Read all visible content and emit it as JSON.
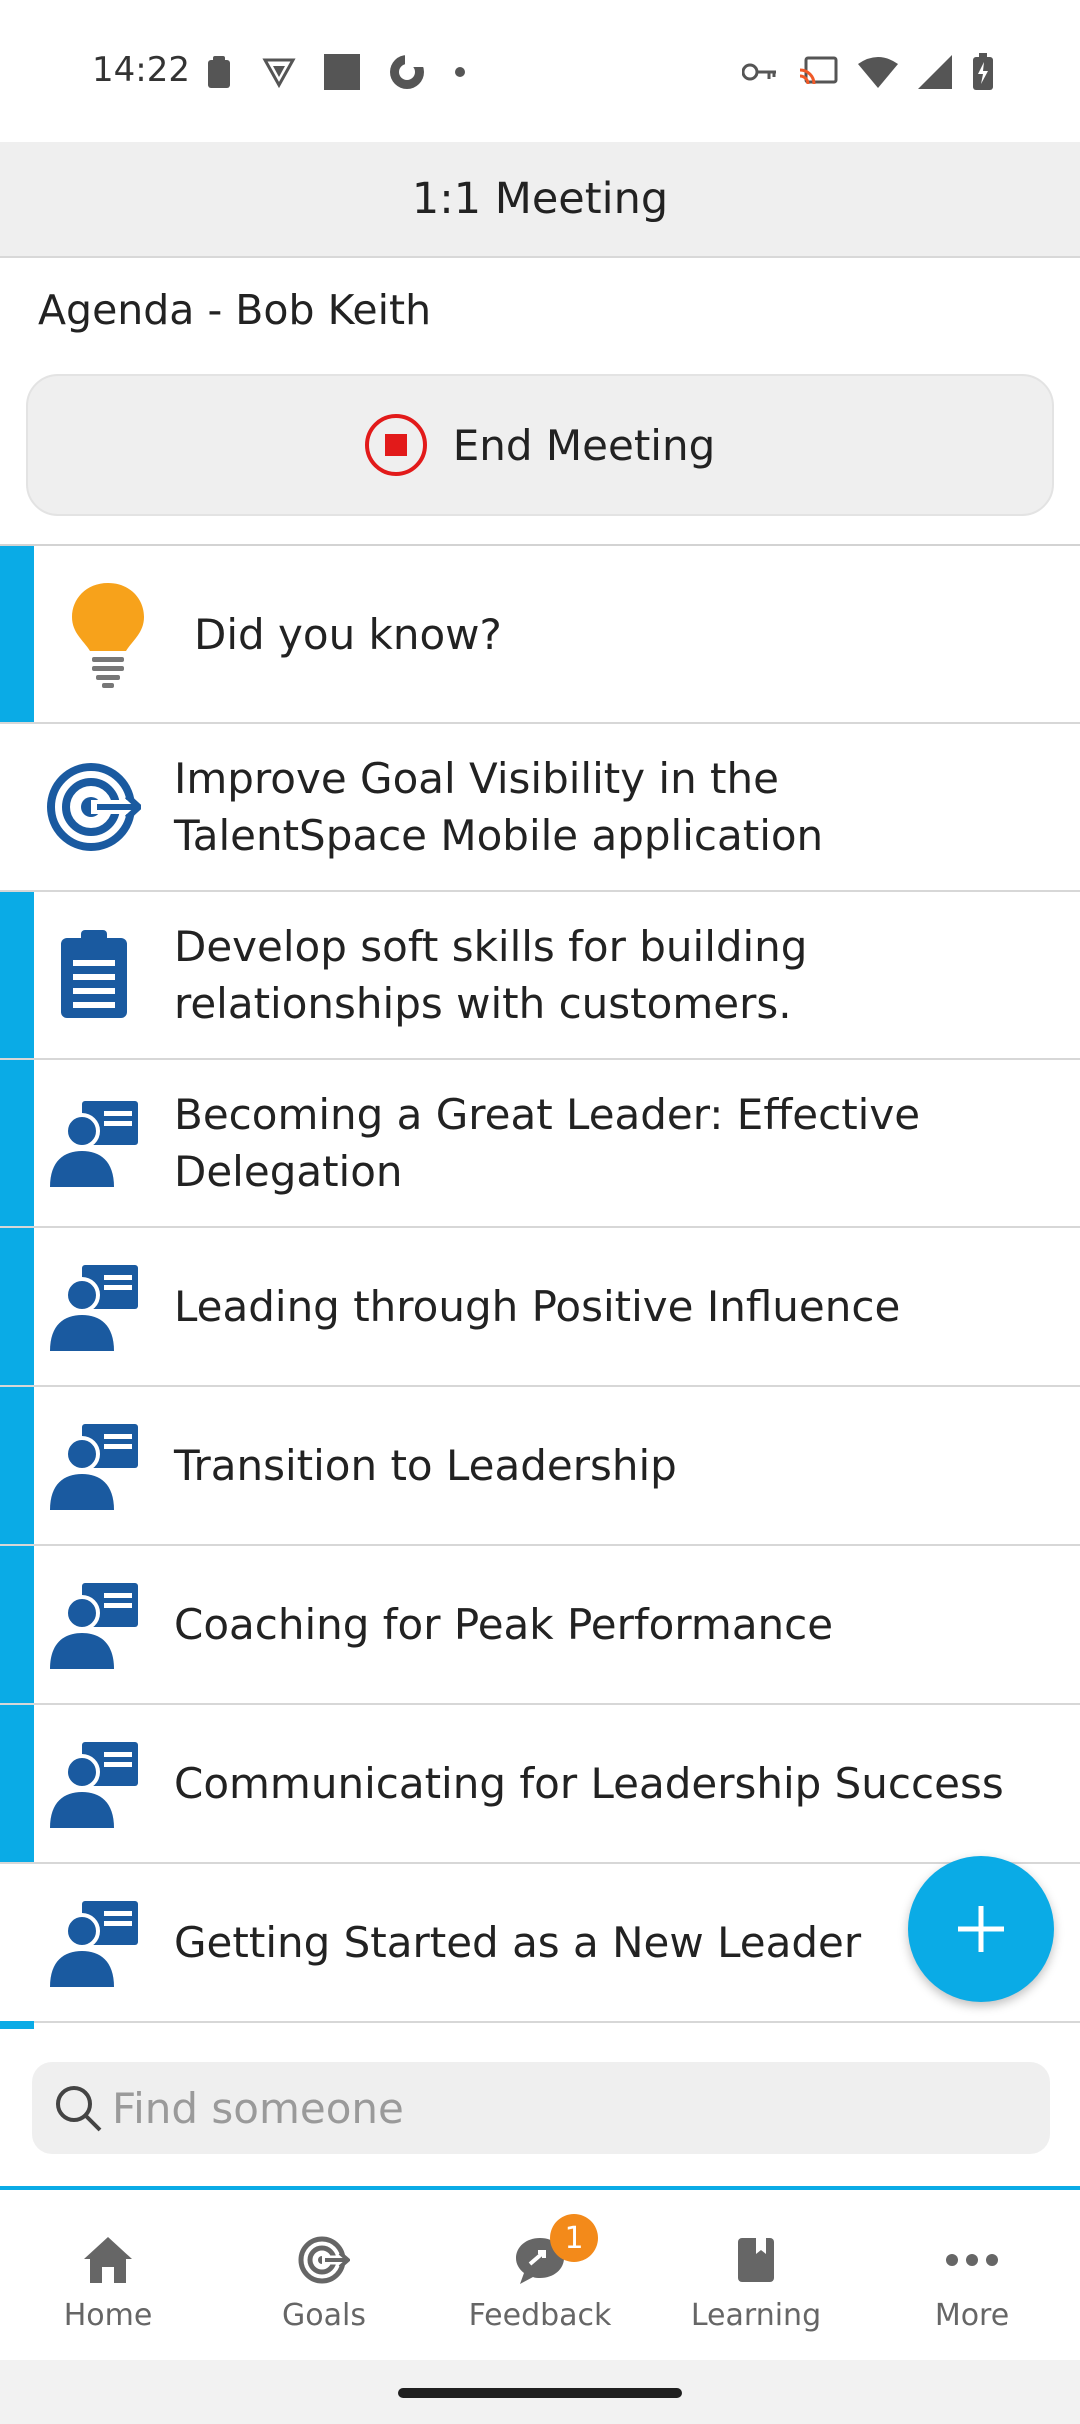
{
  "status_bar": {
    "time": "14:22",
    "left_icons": [
      "clipboard-icon",
      "shield-icon",
      "square-icon",
      "sync-icon",
      "dot-icon"
    ],
    "right_icons": [
      "key-icon",
      "cast-icon",
      "wifi-icon",
      "signal-icon",
      "battery-charging-icon"
    ]
  },
  "header": {
    "title": "1:1 Meeting"
  },
  "agenda": {
    "title": "Agenda - Bob Keith"
  },
  "end_meeting": {
    "label": "End Meeting",
    "icon": "stop-circle-icon",
    "color": "#e21a1a"
  },
  "colors": {
    "accent": "#0aabe6",
    "brand_blue": "#1a5aa0",
    "bulb": "#f7a21b"
  },
  "items": [
    {
      "label": "Did you know?",
      "icon": "lightbulb-icon",
      "accent": true
    },
    {
      "label": "Improve Goal Visibility in the TalentSpace Mobile application",
      "icon": "goal-target-icon",
      "accent": false
    },
    {
      "label": "Develop soft skills for building relationships with customers.",
      "icon": "clipboard-icon",
      "accent": true
    },
    {
      "label": "Becoming a Great Leader: Effective Delegation",
      "icon": "presenter-icon",
      "accent": true
    },
    {
      "label": "Leading through Positive Influence",
      "icon": "presenter-icon",
      "accent": true
    },
    {
      "label": "Transition to Leadership",
      "icon": "presenter-icon",
      "accent": true
    },
    {
      "label": "Coaching for Peak Performance",
      "icon": "presenter-icon",
      "accent": true
    },
    {
      "label": "Communicating for Leadership Success",
      "icon": "presenter-icon",
      "accent": true
    },
    {
      "label": "Getting Started as a New Leader",
      "icon": "presenter-icon",
      "accent": false
    }
  ],
  "fab": {
    "icon": "plus-icon"
  },
  "search": {
    "placeholder": "Find someone",
    "value": ""
  },
  "nav": {
    "items": [
      {
        "label": "Home",
        "icon": "home-icon"
      },
      {
        "label": "Goals",
        "icon": "goals-icon"
      },
      {
        "label": "Feedback",
        "icon": "feedback-icon",
        "badge": "1"
      },
      {
        "label": "Learning",
        "icon": "learning-icon"
      },
      {
        "label": "More",
        "icon": "more-icon"
      }
    ]
  }
}
